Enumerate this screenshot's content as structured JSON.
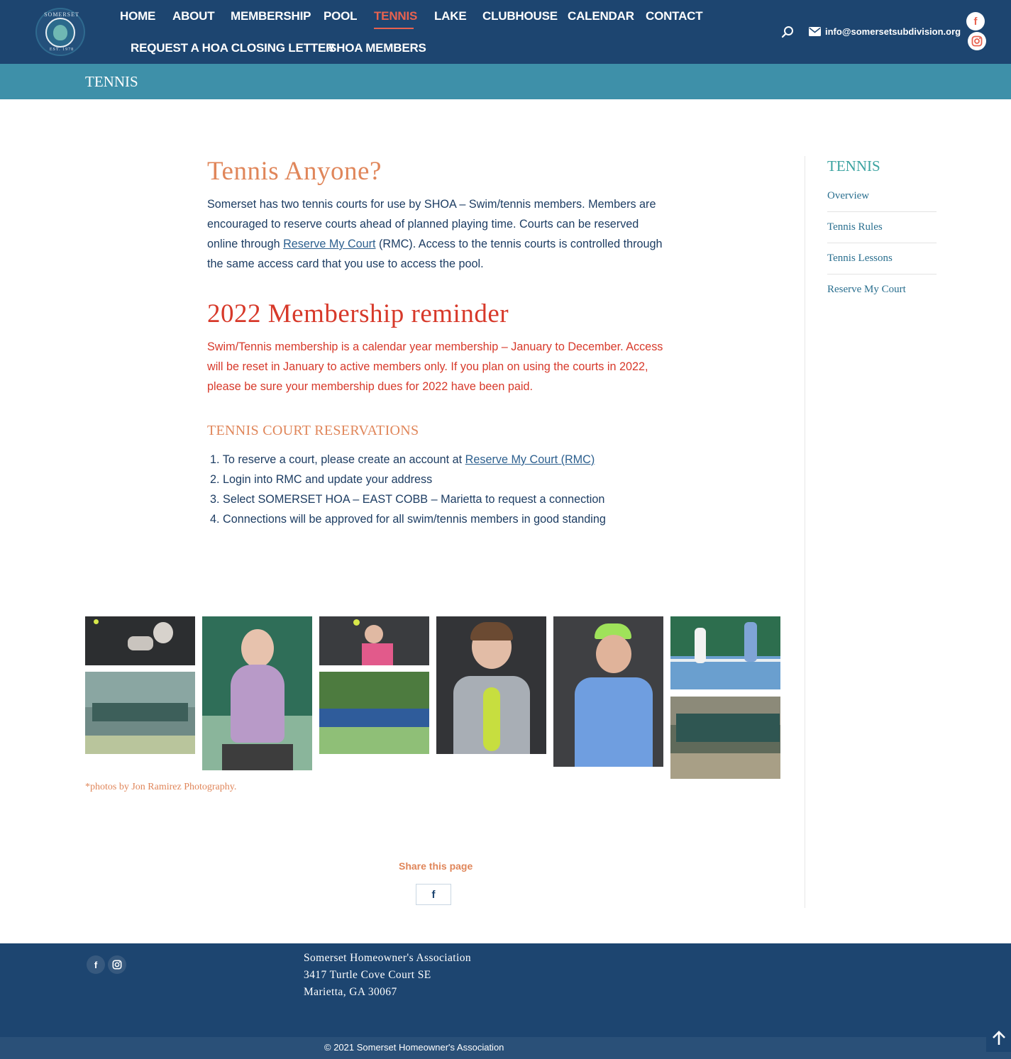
{
  "header": {
    "logo_top_text": "SOMERSET",
    "logo_bottom_text": "EST. 1978",
    "nav": [
      {
        "label": "HOME"
      },
      {
        "label": "ABOUT"
      },
      {
        "label": "MEMBERSHIP"
      },
      {
        "label": "POOL"
      },
      {
        "label": "TENNIS",
        "active": true
      },
      {
        "label": "LAKE"
      },
      {
        "label": "CLUBHOUSE"
      },
      {
        "label": "CALENDAR"
      },
      {
        "label": "CONTACT"
      },
      {
        "label": "REQUEST A HOA CLOSING LETTER"
      },
      {
        "label": "SHOA MEMBERS"
      }
    ],
    "email": "info@somersetsubdivision.org",
    "icons": [
      "search-icon",
      "mail-icon",
      "facebook-icon",
      "instagram-icon"
    ],
    "accent_color": "#e8624f",
    "bg_color": "#1d4570"
  },
  "page_title": "TENNIS",
  "main": {
    "heading": "Tennis Anyone?",
    "intro_before_link": "Somerset has two tennis courts for use by SHOA – Swim/tennis members. Members are encouraged to reserve courts ahead of planned playing time. Courts can be reserved online through ",
    "intro_link": "Reserve My Court",
    "intro_after_link": " (RMC). Access to the tennis courts is controlled through the same access card that you use to access the pool.",
    "reminder_heading": "2022 Membership reminder",
    "reminder_text": "Swim/Tennis membership is a calendar year membership – January to December. Access will be reset in January to active members only. If you plan on using the courts in 2022, please be sure your membership dues for 2022 have been paid.",
    "reservations_heading": "TENNIS COURT RESERVATIONS",
    "steps": [
      {
        "num": "1.",
        "text": "To reserve a court, please create an account at ",
        "link": "Reserve My Court (RMC)"
      },
      {
        "num": "2.",
        "text": "Login into RMC and update your address"
      },
      {
        "num": "3.",
        "text": "Select SOMERSET HOA – EAST COBB – Marietta to request a connection"
      },
      {
        "num": "4.",
        "text": "Connections will be approved for all swim/tennis members in good standing"
      }
    ],
    "photo_caption": "*photos by Jon Ramirez Photography.",
    "share_label": "Share this page",
    "share_button": "f"
  },
  "sidebar": {
    "title": "TENNIS",
    "items": [
      {
        "label": "Overview"
      },
      {
        "label": "Tennis Rules"
      },
      {
        "label": "Tennis Lessons"
      },
      {
        "label": "Reserve My Court"
      }
    ]
  },
  "footer": {
    "address": [
      "Somerset Homeowner's Association",
      "3417 Turtle Cove Court SE",
      "Marietta, GA 30067"
    ],
    "copyright": "© 2021 Somerset Homeowner's Association"
  }
}
